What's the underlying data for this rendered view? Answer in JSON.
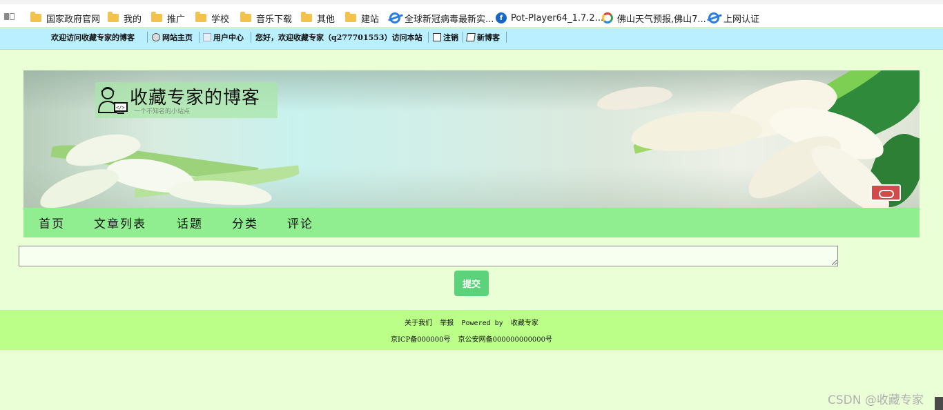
{
  "browser": {
    "bookmarks": [
      {
        "label": "国家政府官网",
        "icon": "folder-icon"
      },
      {
        "label": "我的",
        "icon": "folder-icon"
      },
      {
        "label": "推广",
        "icon": "folder-icon"
      },
      {
        "label": "学校",
        "icon": "folder-icon"
      },
      {
        "label": "音乐下载",
        "icon": "folder-icon"
      },
      {
        "label": "其他",
        "icon": "folder-icon"
      },
      {
        "label": "建站",
        "icon": "folder-icon"
      },
      {
        "label": "全球新冠病毒最新实...",
        "icon": "ie-icon"
      },
      {
        "label": "Pot-Player64_1.7.2...",
        "icon": "potplayer-icon"
      },
      {
        "label": "佛山天气预报,佛山7...",
        "icon": "weather-icon"
      },
      {
        "label": "上网认证",
        "icon": "ie-icon"
      }
    ]
  },
  "site_top": {
    "welcome": "欢迎访问收藏专家的博客",
    "home": "网站主页",
    "user_center": "用户中心",
    "greeting": "您好，欢迎收藏专家（q277701553）访问本站",
    "logout": "注销",
    "new_blog": "新博客"
  },
  "banner": {
    "title": "收藏专家的博客",
    "subtitle": "一个不知名的小站点"
  },
  "nav": {
    "items": [
      "首页",
      "文章列表",
      "话题",
      "分类",
      "评论"
    ]
  },
  "comment": {
    "value": "",
    "submit_label": "提交"
  },
  "footer": {
    "about": "关于我们",
    "report": "举报",
    "powered": "Powered by",
    "powered_name": "收藏专家",
    "icp": "京ICP备000000号",
    "police": "京公安网备000000000000号"
  },
  "watermark": "CSDN @收藏专家",
  "colors": {
    "page_bg": "#eaffd5",
    "top_bar": "#b9efff",
    "nav_bg": "#90ee90",
    "footer_bg": "#bbff88",
    "submit_bg": "#5cd27a"
  }
}
